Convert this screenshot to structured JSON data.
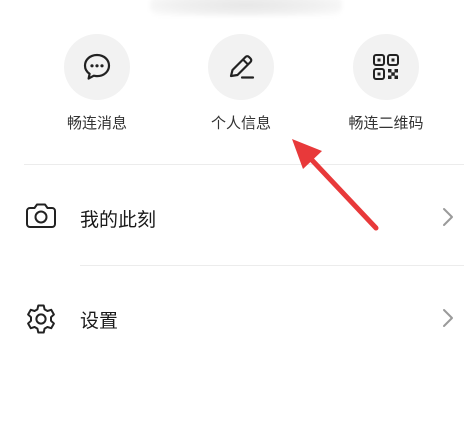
{
  "quick_actions": [
    {
      "label": "畅连消息",
      "icon": "chat-bubble-icon"
    },
    {
      "label": "个人信息",
      "icon": "pencil-edit-icon"
    },
    {
      "label": "畅连二维码",
      "icon": "qr-code-icon"
    }
  ],
  "menu": {
    "moments": {
      "label": "我的此刻",
      "icon": "camera-icon"
    },
    "settings": {
      "label": "设置",
      "icon": "gear-icon"
    }
  },
  "colors": {
    "annotation_arrow": "#e8393a",
    "icon_bg": "#f2f2f2"
  }
}
